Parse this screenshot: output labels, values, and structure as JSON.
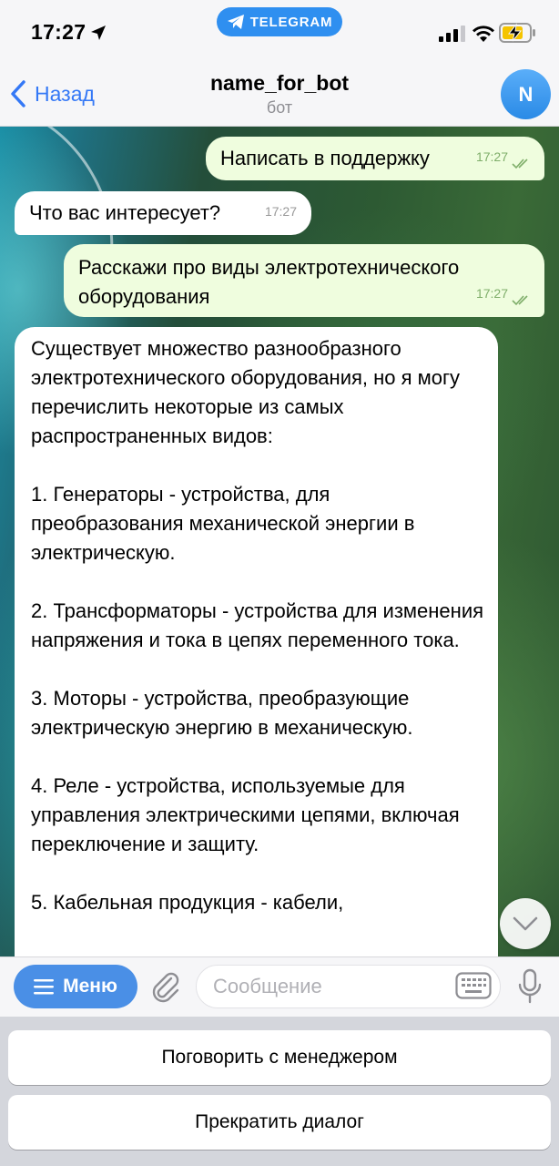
{
  "status_bar": {
    "time": "17:27",
    "telegram_pill": "TELEGRAM"
  },
  "header": {
    "back_label": "Назад",
    "title": "name_for_bot",
    "subtitle": "бот",
    "avatar_letter": "N"
  },
  "messages": [
    {
      "direction": "out",
      "text": "Написать в поддержку",
      "time": "17:27",
      "read": true
    },
    {
      "direction": "in",
      "text": "Что вас интересует?",
      "time": "17:27"
    },
    {
      "direction": "out",
      "text": "Расскажи про виды электротехнического оборудования",
      "time": "17:27",
      "read": true
    },
    {
      "direction": "in",
      "text": "Существует множество разнообразного электротехнического оборудования, но я могу перечислить некоторые из самых распространенных видов:\n\n1. Генераторы - устройства, для преобразования механической энергии в электрическую.\n\n2. Трансформаторы - устройства для изменения напряжения и тока в цепях переменного тока.\n\n3. Моторы - устройства, преобразующие электрическую энергию в механическую.\n\n4. Реле - устройства, используемые для управления электрическими цепями, включая переключение и защиту.\n\n5. Кабельная продукция - кабели,"
    }
  ],
  "input_bar": {
    "menu_label": "Меню",
    "placeholder": "Сообщение"
  },
  "keyboard_buttons": [
    "Поговорить с менеджером",
    "Прекратить диалог"
  ],
  "colors": {
    "accent": "#3478f6",
    "outgoing_bubble": "#effdde",
    "incoming_bubble": "#ffffff",
    "telegram_pill": "#2f8ff0",
    "menu_button": "#4a8fe6"
  }
}
